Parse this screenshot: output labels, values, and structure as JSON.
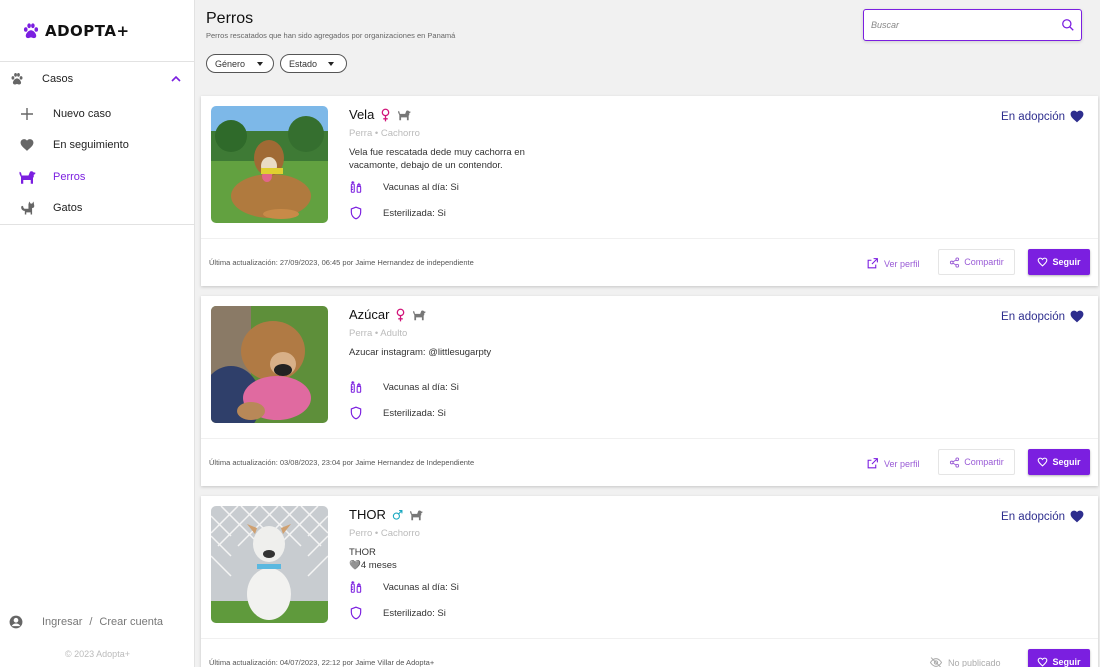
{
  "app": {
    "logo_text": "ADOPTA+",
    "accent": "#7b1fe0",
    "status_color": "#2e2e8e"
  },
  "sidebar": {
    "section": {
      "label": "Casos",
      "icon": "paw-icon"
    },
    "items": [
      {
        "label": "Nuevo caso",
        "icon": "plus-icon"
      },
      {
        "label": "En seguimiento",
        "icon": "heart-icon"
      },
      {
        "label": "Perros",
        "icon": "dog-icon",
        "active": true
      },
      {
        "label": "Gatos",
        "icon": "cat-icon"
      }
    ],
    "login": "Ingresar",
    "separator": "/",
    "register": "Crear cuenta",
    "copyright": "© 2023 Adopta+"
  },
  "header": {
    "title": "Perros",
    "subtitle": "Perros rescatados que han sido agregados por organizaciones en Panamá",
    "search_placeholder": "Buscar",
    "filters": [
      {
        "label": "Género"
      },
      {
        "label": "Estado"
      }
    ]
  },
  "cards": [
    {
      "name": "Vela",
      "sex": "female",
      "subtitle": "Perra • Cachorro",
      "description_lines": [
        "Vela fue rescatada dede muy cachorra en",
        "vacamonte, debajo de un contendor."
      ],
      "vaccines": "Vacunas al día: Si",
      "sterilized": "Esterilizada: Si",
      "status": "En adopción",
      "updated": "Última actualización: 27/09/2023, 06:45 por Jaime Hernandez de independiente",
      "view_profile": "Ver perfil",
      "share": "Compartir",
      "follow": "Seguir"
    },
    {
      "name": "Azúcar",
      "sex": "female",
      "subtitle": "Perra • Adulto",
      "description_lines": [
        "Azucar instagram: @littlesugarpty"
      ],
      "vaccines": "Vacunas al día: Si",
      "sterilized": "Esterilizada: Si",
      "status": "En adopción",
      "updated": "Última actualización: 03/08/2023, 23:04 por Jaime Hernandez de Independiente",
      "view_profile": "Ver perfil",
      "share": "Compartir",
      "follow": "Seguir"
    },
    {
      "name": "THOR",
      "sex": "male",
      "subtitle": "Perro • Cachorro",
      "description_lines": [
        "THOR",
        "🩶4 meses"
      ],
      "vaccines": "Vacunas al día: Si",
      "sterilized": "Esterilizado: Si",
      "status": "En adopción",
      "updated": "Última actualización: 04/07/2023, 22:12 por Jaime Villar de Adopta+",
      "unpublished": "No publicado",
      "follow": "Seguir"
    }
  ]
}
